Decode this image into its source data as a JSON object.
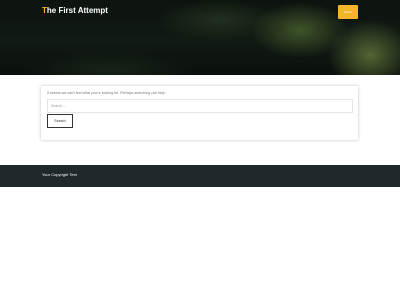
{
  "header": {
    "title_first_letter": "T",
    "title_rest": "he First Attempt",
    "menu_button_label": "Menu"
  },
  "content": {
    "message": "It seems we can't find what you're looking for. Perhaps searching can help.",
    "search_placeholder": "Search ...",
    "search_button_label": "Search"
  },
  "footer": {
    "copyright": "Your Copyright Text"
  },
  "colors": {
    "accent": "#f6b42a",
    "footer_background": "#1f282b",
    "hero_background": "#0f1511"
  }
}
